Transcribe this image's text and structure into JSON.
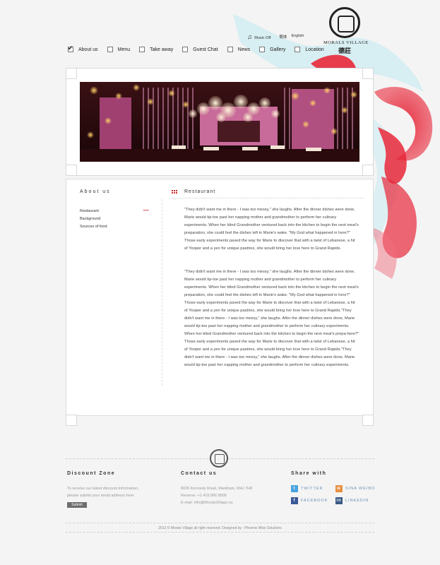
{
  "logo": {
    "name": "MORALS VILLAGE",
    "chinese": "德莊"
  },
  "topbar": {
    "music_label": "Music Off",
    "lang_chinese": "簡体",
    "lang_english": "English"
  },
  "nav": [
    {
      "label": "About us",
      "checked": true
    },
    {
      "label": "Menu",
      "checked": false
    },
    {
      "label": "Take away",
      "checked": false
    },
    {
      "label": "Guest Chat",
      "checked": false
    },
    {
      "label": "News",
      "checked": false
    },
    {
      "label": "Gallery",
      "checked": false
    },
    {
      "label": "Location",
      "checked": false
    }
  ],
  "sidebar": {
    "title": "About us",
    "links": [
      "Restaurant",
      "Background",
      "Sources of food"
    ],
    "active_marker": "•••"
  },
  "section": {
    "title": "Restaurant",
    "paragraphs": [
      "\"They didn't want me in there - I was too messy,\" she laughs. After the dinner dishes were done, Marie would tip-toe past her napping mother and grandmother to perform her culinary experiments. When her blind Grandmother ventured back into the kitchen to begin the next meal's preparation, she could feel the dishes left in Marie's wake. \"My God what happened in here?\" Those early experiments paved the way for Marie to discover that with a twist of Lebanese, a hit of Yooper and a yen for unique pastries, she would bring her love here to Grand Rapids.",
      "\"They didn't want me in there - I was too messy,\" she laughs. After the dinner dishes were done, Marie would tip-toe past her napping mother and grandmother to perform her culinary experiments. When her blind Grandmother ventured back into the kitchen to begin the next meal's preparation, she could feel the dishes left in Marie's wake. \"My God what happened in here?\" Those early experiments paved the way for Marie to discover that with a twist of Lebanese, a hit of Yooper and a yen for unique pastries, she would bring her love here to Grand Rapids.\"They didn't want me in there - I was too messy,\" she laughs. After the dinner dishes were done, Marie would tip-toe past her napping mother and grandmother to perform her culinary experiments. When her blind Grandmother ventured back into the kitchen to begin the next meal's prepa-here?\" Those early experiments paved the way for Marie to discover that with a twist of Lebanese, a hit of Yooper and a yen for unique pastries, she would bring her love here to Grand Rapids.\"They didn't want me in there - I was too messy,\" she laughs. After the dinner dishes were done, Marie would tip-toe past her napping mother and grandmother to perform her culinary experiments."
    ]
  },
  "footer": {
    "discount": {
      "title": "Discount Zone",
      "text_line1": "To receive our latest discount information,",
      "text_line2": "please submit your email address here.",
      "submit_label": "Submit"
    },
    "contact": {
      "title": "Contact us",
      "address": "8026 Kennedy Road, Markham, M4J 7H8",
      "phone": "Reserve: +1 416 866 8900",
      "email": "E-mail: info@MoralsVillage.ca"
    },
    "share": {
      "title": "Share with",
      "twitter": "TWITTER",
      "weibo": "SINA WEIBO",
      "facebook": "FACEBOOK",
      "linkedin": "LINKEDIN"
    },
    "copyright": "2012 © Morals Village all right reserved.   Designed by : Phoenix Wise Solutions"
  },
  "colors": {
    "accent_red": "#c9302c",
    "ink_cyan": "#bfe9f0",
    "link_blue": "#6a8fb5"
  }
}
